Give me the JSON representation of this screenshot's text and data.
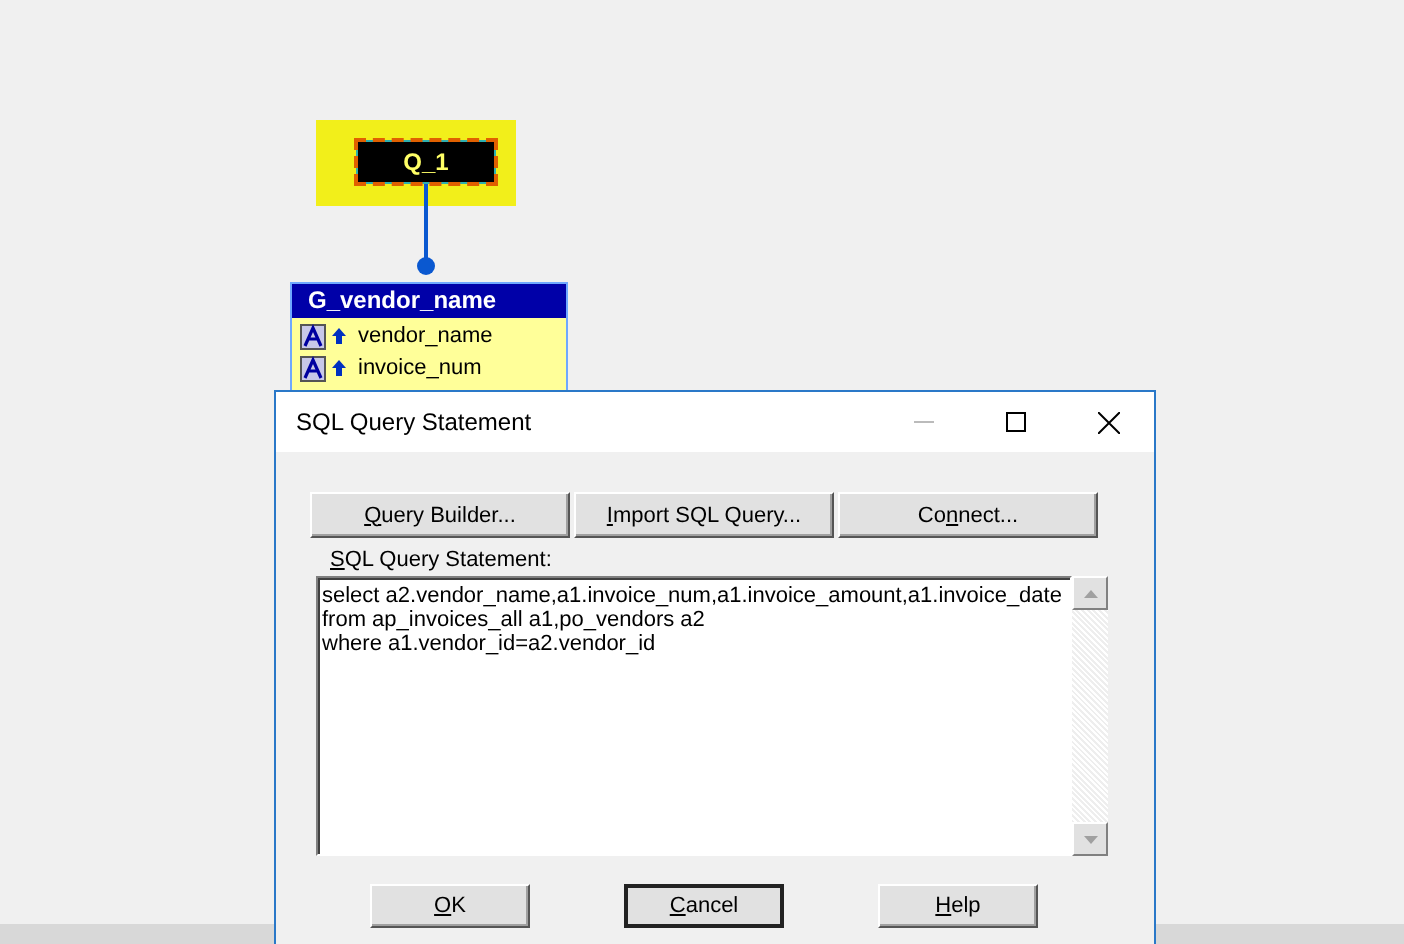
{
  "canvas": {
    "query_node": {
      "label": "Q_1",
      "selected": true
    },
    "group": {
      "title": "G_vendor_name",
      "items": [
        {
          "label": "vendor_name"
        },
        {
          "label": "invoice_num"
        }
      ]
    }
  },
  "dialog": {
    "title": "SQL Query Statement",
    "buttons": [
      {
        "access_key": "Q",
        "after": "uery Builder..."
      },
      {
        "access_key": "I",
        "after": "mport SQL Query..."
      },
      {
        "before": "Co",
        "access_key": "n",
        "after": "nect..."
      }
    ],
    "field_label": {
      "access_key": "S",
      "after": "QL Query Statement:"
    },
    "query_lines": [
      "select a2.vendor_name,a1.invoice_num,a1.invoice_amount,a1.invoice_date",
      "from ap_invoices_all a1,po_vendors a2",
      "where a1.vendor_id=a2.vendor_id"
    ],
    "footer_buttons": [
      {
        "access_key": "O",
        "after": "K",
        "selected": false
      },
      {
        "access_key": "C",
        "after": "ancel",
        "selected": true
      },
      {
        "access_key": "H",
        "after": "elp",
        "selected": false
      }
    ]
  }
}
